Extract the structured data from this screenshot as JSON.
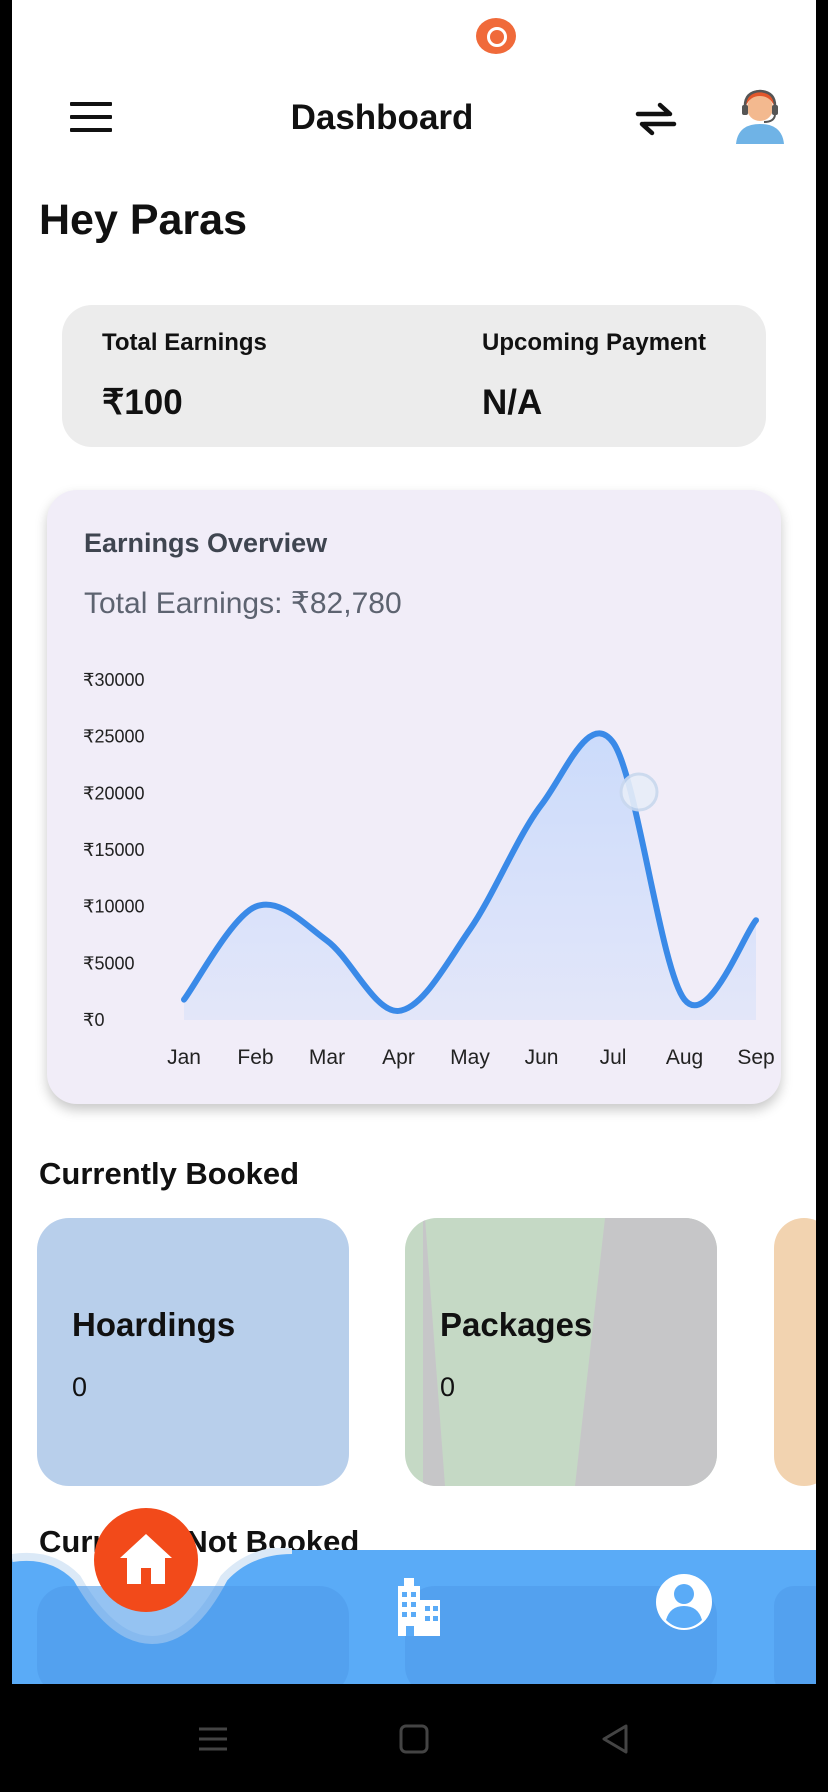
{
  "header": {
    "title": "Dashboard"
  },
  "greeting": "Hey Paras",
  "summary": {
    "total_earnings_label": "Total Earnings",
    "total_earnings_value": "₹100",
    "upcoming_payment_label": "Upcoming Payment",
    "upcoming_payment_value": "N/A"
  },
  "chart_card": {
    "title": "Earnings Overview",
    "subtitle": "Total Earnings: ₹82,780"
  },
  "chart_data": {
    "type": "area",
    "categories": [
      "Jan",
      "Feb",
      "Mar",
      "Apr",
      "May",
      "Jun",
      "Jul",
      "Aug",
      "Sep"
    ],
    "series": [
      {
        "values": [
          1800,
          10000,
          7000,
          800,
          8000,
          19000,
          24500,
          1800,
          8800
        ]
      }
    ],
    "y_ticks": [
      "₹0",
      "₹5000",
      "₹10000",
      "₹15000",
      "₹20000",
      "₹25000",
      "₹30000"
    ],
    "ylim": [
      0,
      30000
    ],
    "grid": false,
    "colors": {
      "line": "#3a8ae8",
      "fill": "#c9dafb"
    }
  },
  "currently_booked": {
    "title": "Currently Booked",
    "tiles": [
      {
        "label": "Hoardings",
        "count": "0"
      },
      {
        "label": "Packages",
        "count": "0"
      }
    ]
  },
  "currently_not_booked": {
    "title": "Currently Not Booked"
  },
  "colors": {
    "accent_orange": "#f24a1a",
    "nav_blue": "#5aabf7",
    "tile_blue": "#b8cfeb",
    "tile_green": "#c5d9c5"
  },
  "icons": {
    "menu": "hamburger-icon",
    "swap": "swap-arrows-icon",
    "avatar": "support-agent-avatar",
    "home": "home-icon",
    "building": "building-icon",
    "profile": "profile-icon"
  }
}
